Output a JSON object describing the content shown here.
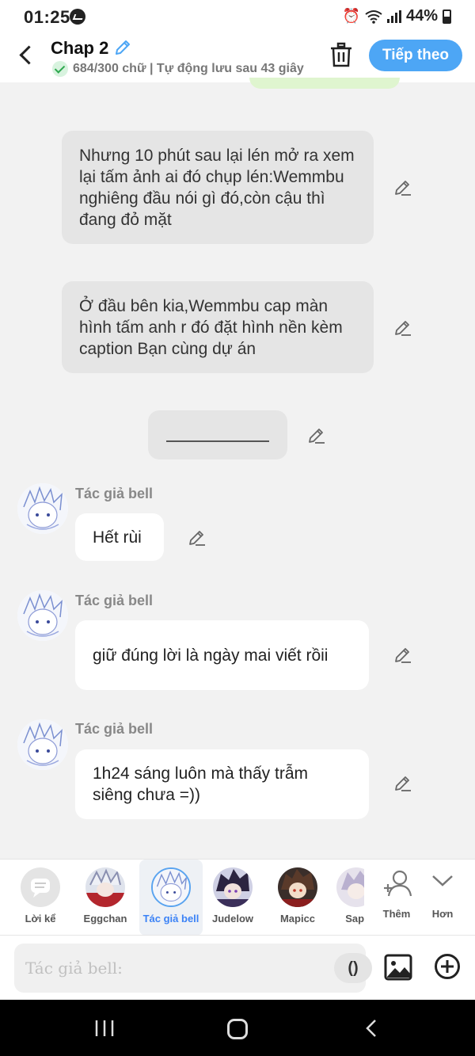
{
  "status_bar": {
    "time": "01:25",
    "battery": "44%",
    "icons": [
      "messenger-icon",
      "alarm-icon",
      "wifi-icon",
      "signal-icon",
      "battery-icon"
    ]
  },
  "header": {
    "title": "Chap 2",
    "subtitle": "684/300 chữ | Tự động lưu sau 43 giây",
    "next_button": "Tiếp theo",
    "accent_color": "#4da6f5"
  },
  "messages": [
    {
      "type": "narration",
      "text": "Nhưng 10 phút sau lại lén mở ra xem lại tấm ảnh ai đó chụp lén:Wemmbu nghiêng đầu nói gì đó,còn cậu thì đang đỏ mặt"
    },
    {
      "type": "narration",
      "text": "Ở đầu bên kia,Wemmbu cap màn hình tấm anh r đó đặt hình nền kèm caption Bạn cùng dự án"
    },
    {
      "type": "divider",
      "text": ""
    },
    {
      "type": "character",
      "author": "Tác giả bell",
      "text": "Hết rùi"
    },
    {
      "type": "character",
      "author": "Tác giả bell",
      "text": "giữ đúng lời là ngày mai viết rồii"
    },
    {
      "type": "character",
      "author": "Tác giả bell",
      "text": "1h24 sáng luôn mà thấy trẫm siêng chưa =))"
    }
  ],
  "characters": [
    {
      "label": "Lời kể",
      "icon": "narration-icon"
    },
    {
      "label": "Eggchan"
    },
    {
      "label": "Tác giả bell",
      "active": true
    },
    {
      "label": "Judelow"
    },
    {
      "label": "Mapicc"
    },
    {
      "label": "Sapi"
    }
  ],
  "char_actions": {
    "add_label": "Thêm",
    "more_label": "Hơn"
  },
  "composer": {
    "placeholder": "Tác giả bell:",
    "paren_label": "()"
  }
}
